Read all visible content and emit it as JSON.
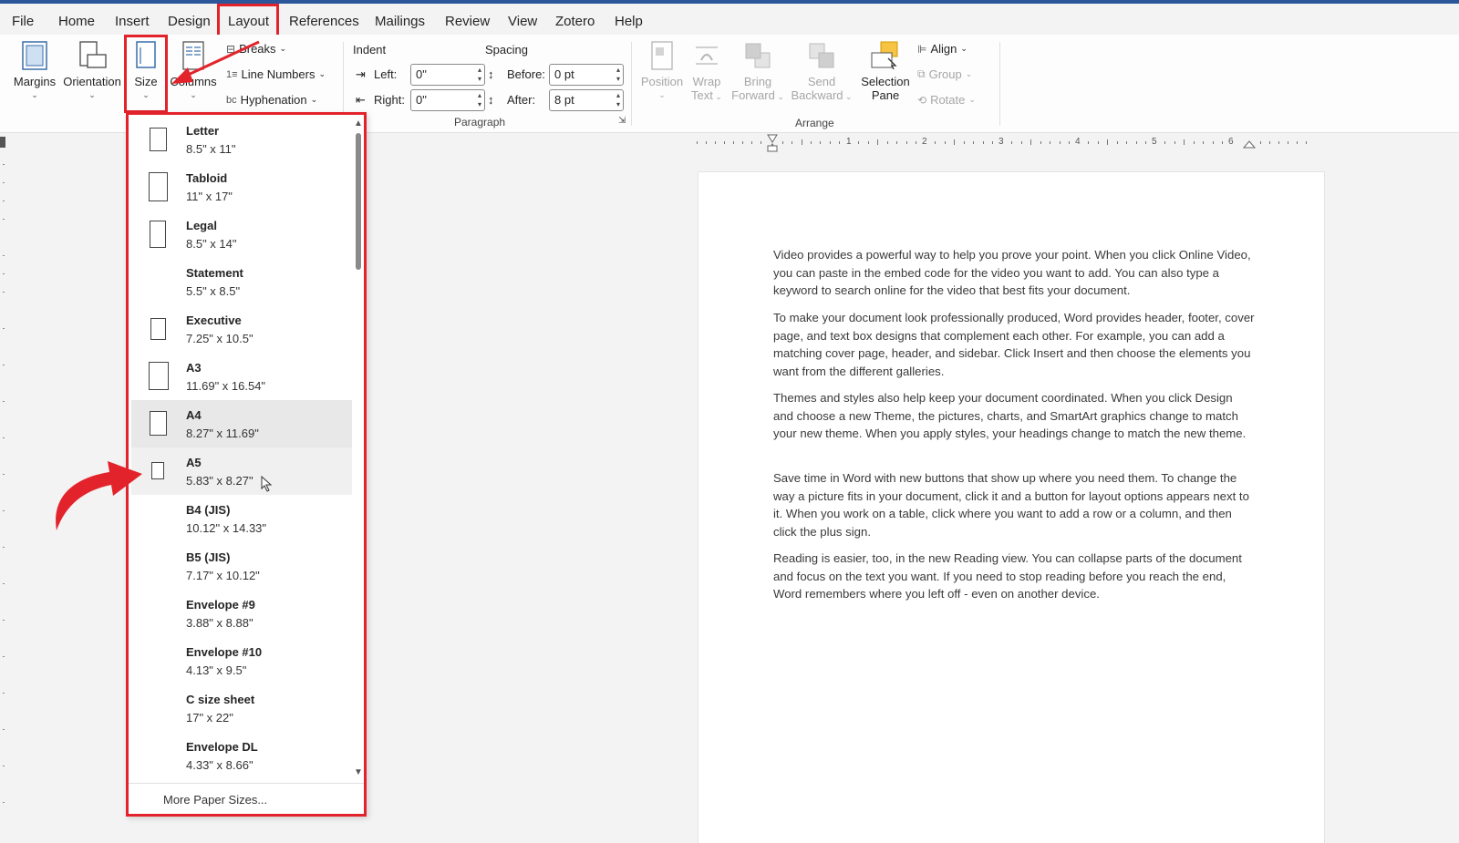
{
  "menu_tabs": [
    "File",
    "Home",
    "Insert",
    "Design",
    "Layout",
    "References",
    "Mailings",
    "Review",
    "View",
    "Zotero",
    "Help"
  ],
  "active_tab": "Layout",
  "ribbon": {
    "margins": "Margins",
    "orientation": "Orientation",
    "size": "Size",
    "columns": "Columns",
    "breaks": "Breaks",
    "line_numbers": "Line Numbers",
    "hyphenation": "Hyphenation",
    "indent_label": "Indent",
    "spacing_label": "Spacing",
    "left_label": "Left:",
    "right_label": "Right:",
    "before_label": "Before:",
    "after_label": "After:",
    "indent_left": "0\"",
    "indent_right": "0\"",
    "spacing_before": "0 pt",
    "spacing_after": "8 pt",
    "paragraph_group": "Paragraph",
    "position": "Position",
    "wrap_text_1": "Wrap",
    "wrap_text_2": "Text",
    "bring_forward_1": "Bring",
    "bring_forward_2": "Forward",
    "send_backward_1": "Send",
    "send_backward_2": "Backward",
    "selection_pane_1": "Selection",
    "selection_pane_2": "Pane",
    "align": "Align",
    "group": "Group",
    "rotate": "Rotate",
    "arrange_group": "Arrange"
  },
  "ruler_numbers": [
    "1",
    "2",
    "3",
    "4",
    "5",
    "6"
  ],
  "size_dropdown": {
    "items": [
      {
        "name": "Letter",
        "dims": "8.5\" x 11\""
      },
      {
        "name": "Tabloid",
        "dims": "11\" x 17\""
      },
      {
        "name": "Legal",
        "dims": "8.5\" x 14\""
      },
      {
        "name": "Statement",
        "dims": "5.5\" x 8.5\""
      },
      {
        "name": "Executive",
        "dims": "7.25\" x 10.5\""
      },
      {
        "name": "A3",
        "dims": "11.69\" x 16.54\""
      },
      {
        "name": "A4",
        "dims": "8.27\" x 11.69\""
      },
      {
        "name": "A5",
        "dims": "5.83\" x 8.27\""
      },
      {
        "name": "B4 (JIS)",
        "dims": "10.12\" x 14.33\""
      },
      {
        "name": "B5 (JIS)",
        "dims": "7.17\" x 10.12\""
      },
      {
        "name": "Envelope #9",
        "dims": "3.88\" x 8.88\""
      },
      {
        "name": "Envelope #10",
        "dims": "4.13\" x 9.5\""
      },
      {
        "name": "C size sheet",
        "dims": "17\" x 22\""
      },
      {
        "name": "Envelope DL",
        "dims": "4.33\" x 8.66\""
      }
    ],
    "selected": "A4",
    "hovered": "A5",
    "more": "More Paper Sizes..."
  },
  "document": {
    "paragraphs": [
      "Video provides a powerful way to help you prove your point. When you click Online Video, you can paste in the embed code for the video you want to add. You can also type a keyword to search online for the video that best fits your document.",
      "To make your document look professionally produced, Word provides header, footer, cover page, and text box designs that complement each other. For example, you can add a matching cover page, header, and sidebar. Click Insert and then choose the elements you want from the different galleries.",
      "Themes and styles also help keep your document coordinated. When you click Design and choose a new Theme, the pictures, charts, and SmartArt graphics change to match your new theme. When you apply styles, your headings change to match the new theme.",
      "Save time in Word with new buttons that show up where you need them. To change the way a picture fits in your document, click it and a button for layout options appears next to it. When you work on a table, click where you want to add a row or a column, and then click the plus sign.",
      "Reading is easier, too, in the new Reading view. You can collapse parts of the document and focus on the text you want. If you need to stop reading before you reach the end, Word remembers where you left off - even on another device."
    ]
  },
  "colors": {
    "highlight": "#e3232c",
    "accent": "#2b579a"
  }
}
